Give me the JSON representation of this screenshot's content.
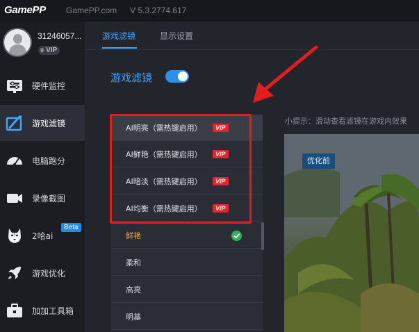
{
  "app": {
    "logo": "GamePP",
    "site": "GamePP.com",
    "version": "V 5.3.2774.617"
  },
  "user": {
    "id": "31246057...",
    "vip_badge": "VIP"
  },
  "sidebar": {
    "items": [
      {
        "label": "硬件监控",
        "icon": "hardware-monitor-icon",
        "active": false
      },
      {
        "label": "游戏滤镜",
        "icon": "game-filter-icon",
        "active": true
      },
      {
        "label": "电脑跑分",
        "icon": "benchmark-gauge-icon",
        "active": false
      },
      {
        "label": "录像截图",
        "icon": "video-camera-icon",
        "active": false
      },
      {
        "label": "2哈ai",
        "icon": "husky-ai-icon",
        "active": false,
        "badge": "Beta"
      },
      {
        "label": "游戏优化",
        "icon": "rocket-icon",
        "active": false
      },
      {
        "label": "加加工具箱",
        "icon": "toolbox-icon",
        "active": false
      }
    ]
  },
  "tabs": [
    {
      "label": "游戏滤镜",
      "active": true
    },
    {
      "label": "显示设置",
      "active": false
    }
  ],
  "filter_section": {
    "title": "游戏滤镜",
    "toggle_on": true,
    "hint": "小提示：滑动查看滤镜在游戏内效果"
  },
  "filters": [
    {
      "label": "AI明亮（需热键启用）",
      "vip": "VIP"
    },
    {
      "label": "AI鲜艳（需热键启用）",
      "vip": "VIP"
    },
    {
      "label": "AI暗淡（需热键启用）",
      "vip": "VIP"
    },
    {
      "label": "AI均衡（需热键启用）",
      "vip": "VIP"
    },
    {
      "label": "鲜艳",
      "selected": true
    },
    {
      "label": "柔和"
    },
    {
      "label": "高亮"
    },
    {
      "label": "明基"
    }
  ],
  "preview": {
    "tag": "优化前"
  },
  "colors": {
    "accent": "#3fa5ff",
    "vip_red": "#e1262c",
    "annotation_red": "#e11d1d",
    "selected_text": "#e8a33d",
    "check_green": "#2cb35a"
  }
}
